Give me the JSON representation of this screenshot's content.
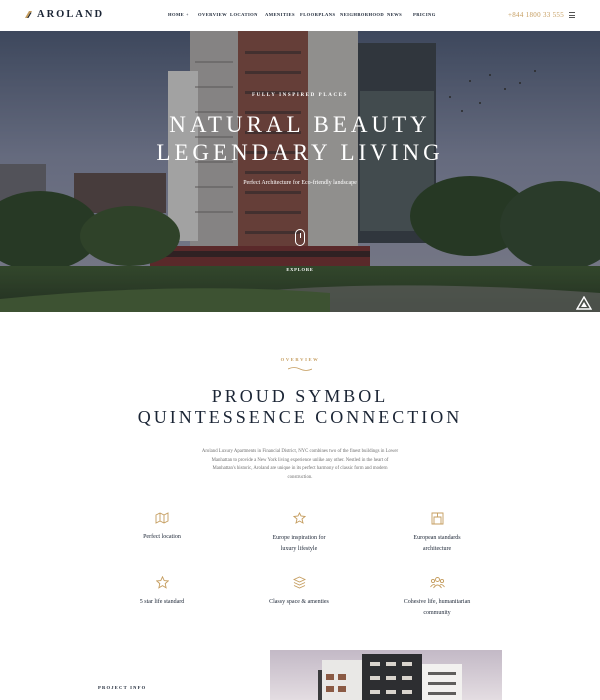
{
  "header": {
    "logo_text": "AROLAND",
    "nav": [
      {
        "label": "HOME",
        "has_caret": true
      },
      {
        "label": "OVERVIEW"
      },
      {
        "label": "LOCATION"
      },
      {
        "label": "AMENITIES"
      },
      {
        "label": "FLOORPLANS"
      },
      {
        "label": "NEIGHBORHOOD"
      },
      {
        "label": "NEWS"
      },
      {
        "label": "PRICING"
      }
    ],
    "caret": "+",
    "phone": "+844 1800 33 555"
  },
  "hero": {
    "kicker": "FULLY INSPIRED PLACES",
    "title_line1": "NATURAL BEAUTY",
    "title_line2": "LEGENDARY LIVING",
    "subtitle": "Perfect Architecture for Eco-friendly landscape",
    "explore": "EXPLORE"
  },
  "overview": {
    "kicker": "OVERVIEW",
    "title_line1": "PROUD SYMBOL",
    "title_line2": "QUINTESSENCE CONNECTION",
    "body": "Aroland Luxury Apartments in Financial District, NYC combines two of the finest buildings in Lower Manhattan to provide a New York living experience unlike any other. Nestled in the heart of Manhattan's historic, Aroland are unique in its perfect harmony of classic form and modern construction.",
    "features": [
      {
        "icon": "map-icon",
        "line1": "Perfect location",
        "line2": ""
      },
      {
        "icon": "leaf-icon",
        "line1": "Europe inspiration for",
        "line2": "luxury lifestyle"
      },
      {
        "icon": "building-icon",
        "line1": "European standards",
        "line2": "architecture"
      },
      {
        "icon": "star-icon",
        "line1": "5 star life standard",
        "line2": ""
      },
      {
        "icon": "layers-icon",
        "line1": "Classy space & amenties",
        "line2": ""
      },
      {
        "icon": "community-icon",
        "line1": "Cohesive life, humanitarian",
        "line2": "community"
      }
    ]
  },
  "project": {
    "label": "PROJECT INFO"
  },
  "colors": {
    "accent": "#c59d5f",
    "heading": "#1b2535",
    "body_text": "#6f6f6f"
  }
}
